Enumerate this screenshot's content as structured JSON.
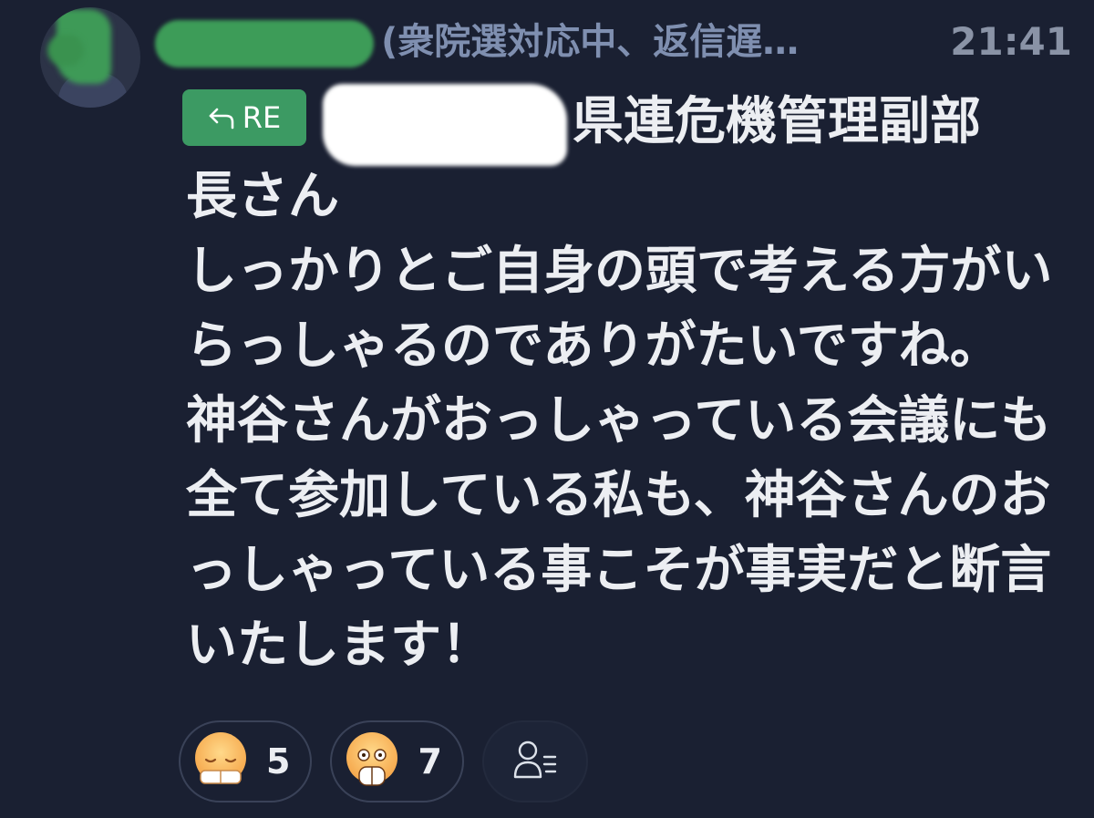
{
  "header": {
    "status": "(衆院選対応中、返信遅…",
    "time": "21:41"
  },
  "reply": {
    "re_label": "RE",
    "icon": "reply-arrow-icon"
  },
  "message": {
    "lines": [
      "県連危機管理副部",
      "長さん",
      "しっかりとご自身の頭で考える方がい",
      "らっしゃるのでありがたいですね。",
      "神谷さんがおっしゃっている会議にも",
      "全て参加している私も、神谷さんのお",
      "っしゃっている事こそが事実だと断言",
      "いたします！"
    ]
  },
  "reactions": [
    {
      "icon": "exhausted-face-icon",
      "count": "5"
    },
    {
      "icon": "shocked-face-icon",
      "count": "7"
    }
  ],
  "add_reaction_icon": "user-list-icon",
  "colors": {
    "background": "#1a2032",
    "accent_green": "#3c9a63",
    "muted_text": "#7f8fb0"
  }
}
